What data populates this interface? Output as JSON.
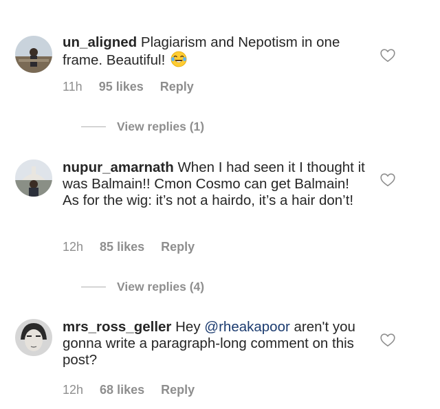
{
  "comments": [
    {
      "username": "un_aligned",
      "text": "Plagiarism and Nepotism in one frame. Beautiful!",
      "emoji": "face-with-tears-of-joy",
      "time": "11h",
      "likes": "95 likes",
      "reply": "Reply",
      "view_replies": "View replies (1)"
    },
    {
      "username": "nupur_amarnath",
      "text": "When I had seen it I thought it was Balmain!! Cmon Cosmo can get Balmain! As for the wig: it’s not a hairdo, it’s a hair don’t!",
      "time": "12h",
      "likes": "85 likes",
      "reply": "Reply",
      "view_replies": "View replies (4)"
    },
    {
      "username": "mrs_ross_geller",
      "text_before": "Hey",
      "mention": "@rheakapoor",
      "text_after": "aren't you gonna write a paragraph-long comment on this post?",
      "time": "12h",
      "likes": "68 likes",
      "reply": "Reply"
    }
  ],
  "icons": {
    "like": "heart-outline-icon",
    "emoji": "face-with-tears-of-joy"
  },
  "colors": {
    "text": "#262626",
    "muted": "#8e8e8e",
    "mention": "#1b3b6f"
  }
}
